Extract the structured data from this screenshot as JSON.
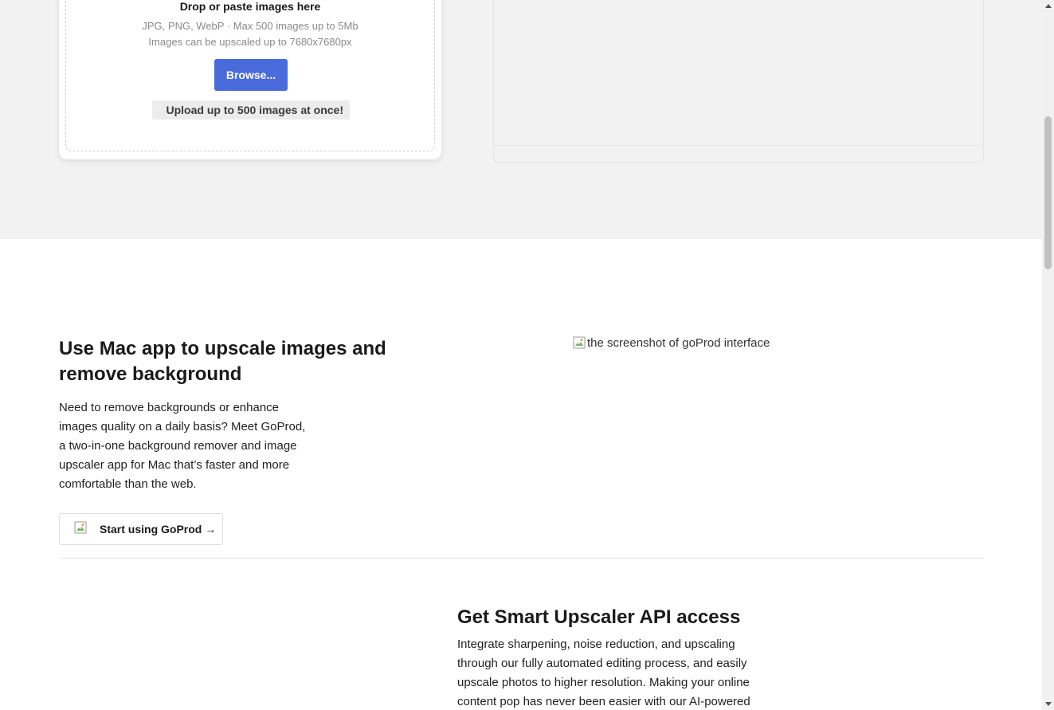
{
  "upload": {
    "drop_title": "Drop or paste images here",
    "formats": "JPG, PNG, WebP · Max 500 images up to 5Mb",
    "limit": "Images can be upscaled up to 7680x7680px",
    "browse_label": "Browse...",
    "bulk_note": "Upload up to 500 images at once!"
  },
  "mac_app": {
    "title": "Use Mac app to upscale images and remove background",
    "description": "Need to remove backgrounds or enhance images quality on a daily basis? Meet GoProd, a two-in-one background remover and image upscaler app for Mac that’s faster and more comfortable than the web.",
    "cta_label": "Start using GoProd →",
    "screenshot_alt": "the screenshot of goProd interface"
  },
  "api": {
    "title": "Get Smart Upscaler API access",
    "description": "Integrate sharpening, noise reduction, and upscaling through our fully automated editing process, and easily upscale photos to higher resolution. Making your online content pop has never been easier with our AI-powered"
  },
  "colors": {
    "accent": "#4a6bdc",
    "section_bg": "#f2f2f2"
  },
  "icons": {
    "broken_image": "broken-image-icon",
    "scroll_up": "scroll-up-arrow-icon",
    "scroll_down": "scroll-down-arrow-icon"
  }
}
